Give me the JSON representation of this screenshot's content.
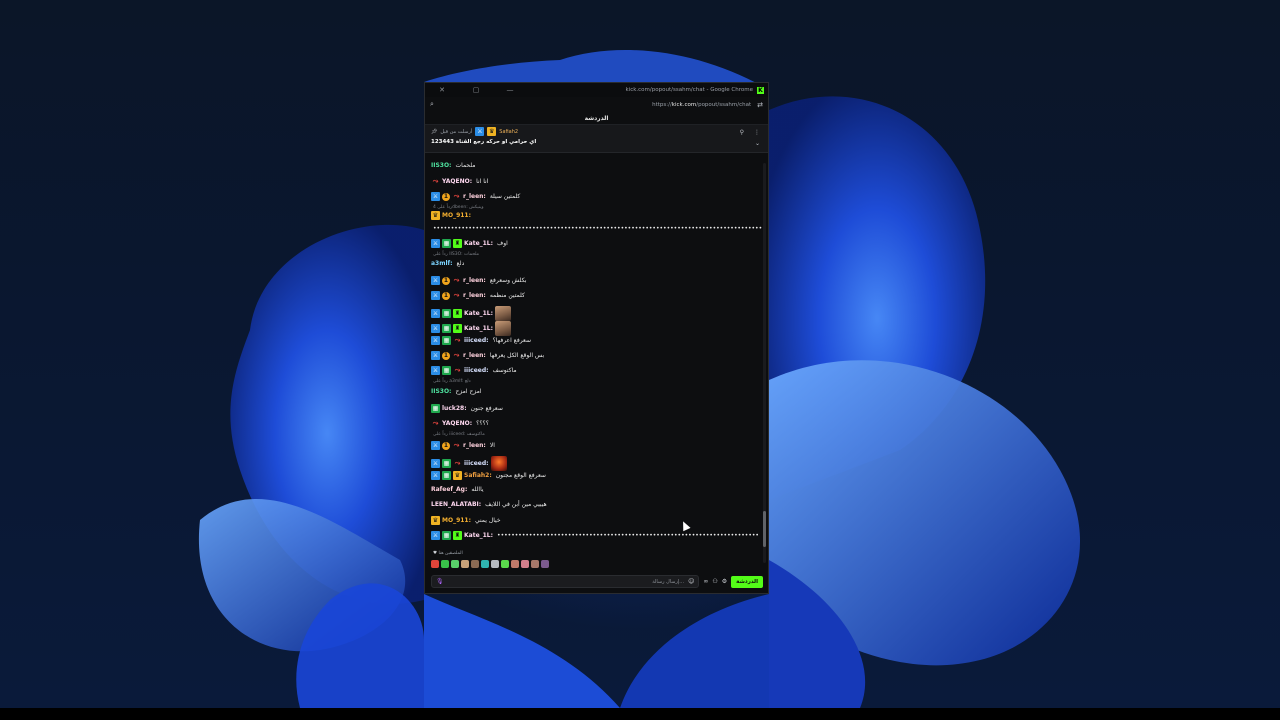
{
  "window": {
    "title": "kick.com/popout/ssahm/chat - Google Chrome",
    "url_prefix": "https://",
    "url_domain": "kick.com",
    "url_path": "/popout/ssahm/chat"
  },
  "chat": {
    "header": "الدردشة",
    "pinned": {
      "author": "Safiah2",
      "meta": "أرسلت من قبل",
      "message": "اي حرامي او حركه رجع القناة 123443"
    },
    "messages": [
      {
        "user": "IIS3O",
        "color": "#4fe3a0",
        "text": "ملحمات",
        "badges": []
      },
      {
        "user": "YAQENO",
        "color": "#ffd8f0",
        "text": "انا انا",
        "badges": [
          "red"
        ]
      },
      {
        "user": "r_leen",
        "color": "#ffd2de",
        "text": "كلمتين سيلة",
        "badges": [
          "blue",
          "gold",
          "red"
        ]
      },
      {
        "reply": "رداً على 4dbeen: وينيكش"
      },
      {
        "user": "MO_911",
        "color": "#f5b030",
        "text": "",
        "badges": [
          "crown"
        ]
      },
      {
        "user": "",
        "color": "#eaeaea",
        "text": "•••••••••••••••••••••••••••••••••••••••••••••••••••••••••••••••••••••••••••••••••••••••••••••",
        "badges": []
      },
      {
        "user": "Kate_1L",
        "color": "#ffd8f0",
        "text": "اوف",
        "badges": [
          "blue",
          "green2",
          "green"
        ]
      },
      {
        "reply": "رداً على IIS3O: ملحمات"
      },
      {
        "user": "a3mlf",
        "color": "#7cd4ff",
        "text": "دلع",
        "badges": []
      },
      {
        "user": "r_leen",
        "color": "#ffd2de",
        "text": "بكلش وسعرفع",
        "badges": [
          "blue",
          "gold",
          "red"
        ]
      },
      {
        "user": "r_leen",
        "color": "#ffd2de",
        "text": "كلمتين منظمه",
        "badges": [
          "blue",
          "gold",
          "red"
        ]
      },
      {
        "user": "Kate_1L",
        "color": "#ffd8f0",
        "text": "",
        "badges": [
          "blue",
          "green2",
          "green"
        ],
        "emote": "face"
      },
      {
        "user": "Kate_1L",
        "color": "#ffd8f0",
        "text": "",
        "badges": [
          "blue",
          "green2",
          "green"
        ],
        "emote": "face"
      },
      {
        "user": "iiiceed",
        "color": "#d8e2ff",
        "text": "سعرفع اعرفها؟",
        "badges": [
          "blue",
          "green2",
          "red"
        ]
      },
      {
        "user": "r_leen",
        "color": "#ffd2de",
        "text": "بس الوقع الكل يعرفها",
        "badges": [
          "blue",
          "gold",
          "red"
        ]
      },
      {
        "user": "iiiceed",
        "color": "#d8e2ff",
        "text": "ماكتوسف",
        "badges": [
          "blue",
          "green2",
          "red"
        ]
      },
      {
        "reply": "رداً على a3mlf: دلع"
      },
      {
        "user": "IIS3O",
        "color": "#4fe3a0",
        "text": "امزح امزح",
        "badges": []
      },
      {
        "user": "luck28",
        "color": "#ffd8f0",
        "text": "سعرفع جنون",
        "badges": [
          "green2"
        ]
      },
      {
        "user": "YAQENO",
        "color": "#ffd8f0",
        "text": "؟؟؟؟",
        "badges": [
          "red"
        ]
      },
      {
        "reply": "رداً على iiiceed: ماكتوسف"
      },
      {
        "user": "r_leen",
        "color": "#ffd2de",
        "text": "الا",
        "badges": [
          "blue",
          "gold",
          "red"
        ]
      },
      {
        "user": "iiiceed",
        "color": "#d8e2ff",
        "text": "",
        "badges": [
          "blue",
          "green2",
          "red"
        ],
        "emote": "fire"
      },
      {
        "user": "Safiah2",
        "color": "#f0a040",
        "text": "سعرفع الوقع مجنون",
        "badges": [
          "blue",
          "green2",
          "crown"
        ]
      },
      {
        "user": "Rafeef_Ag",
        "color": "#ffd2de",
        "text": "ياالله",
        "badges": []
      },
      {
        "user": "LEEN_ALATABI",
        "color": "#ffd8f0",
        "text": "هيييي مين أبن في اللايف",
        "badges": []
      },
      {
        "user": "MO_911",
        "color": "#f5b030",
        "text": "خيال يمني",
        "badges": [
          "crown"
        ]
      },
      {
        "user": "Kate_1L",
        "color": "#ffd8f0",
        "text": "••••••••••••••••••••••••••••••••••••••••••••••••••••••••••••••••••••••••••",
        "badges": [
          "blue",
          "green2",
          "green"
        ]
      }
    ],
    "pinned_emotes_label": "الملصقين هنا",
    "composer": {
      "placeholder": "إرسال رسالة...",
      "send_label": "الدردشة"
    }
  }
}
